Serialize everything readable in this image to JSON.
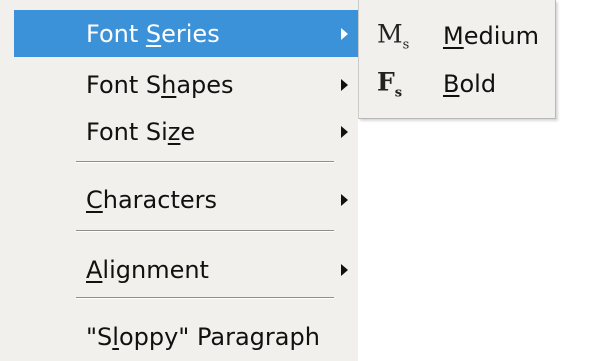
{
  "menu": {
    "items": [
      {
        "pre": "Font ",
        "ul": "S",
        "post": "eries"
      },
      {
        "pre": "Font S",
        "ul": "h",
        "post": "apes"
      },
      {
        "pre": "Font Si",
        "ul": "z",
        "post": "e"
      },
      {
        "pre": "",
        "ul": "C",
        "post": "haracters"
      },
      {
        "pre": "",
        "ul": "A",
        "post": "lignment"
      },
      {
        "pre": "\"S",
        "ul": "l",
        "post": "oppy\" Paragraph"
      }
    ]
  },
  "submenu": {
    "items": [
      {
        "icon_char": "M",
        "icon_sub": "s",
        "ul": "M",
        "post": "edium"
      },
      {
        "icon_char": "F",
        "icon_sub": "s",
        "ul": "B",
        "post": "old"
      }
    ]
  },
  "colors": {
    "highlight": "#3b92d8",
    "menu_bg": "#f1f0ec"
  }
}
